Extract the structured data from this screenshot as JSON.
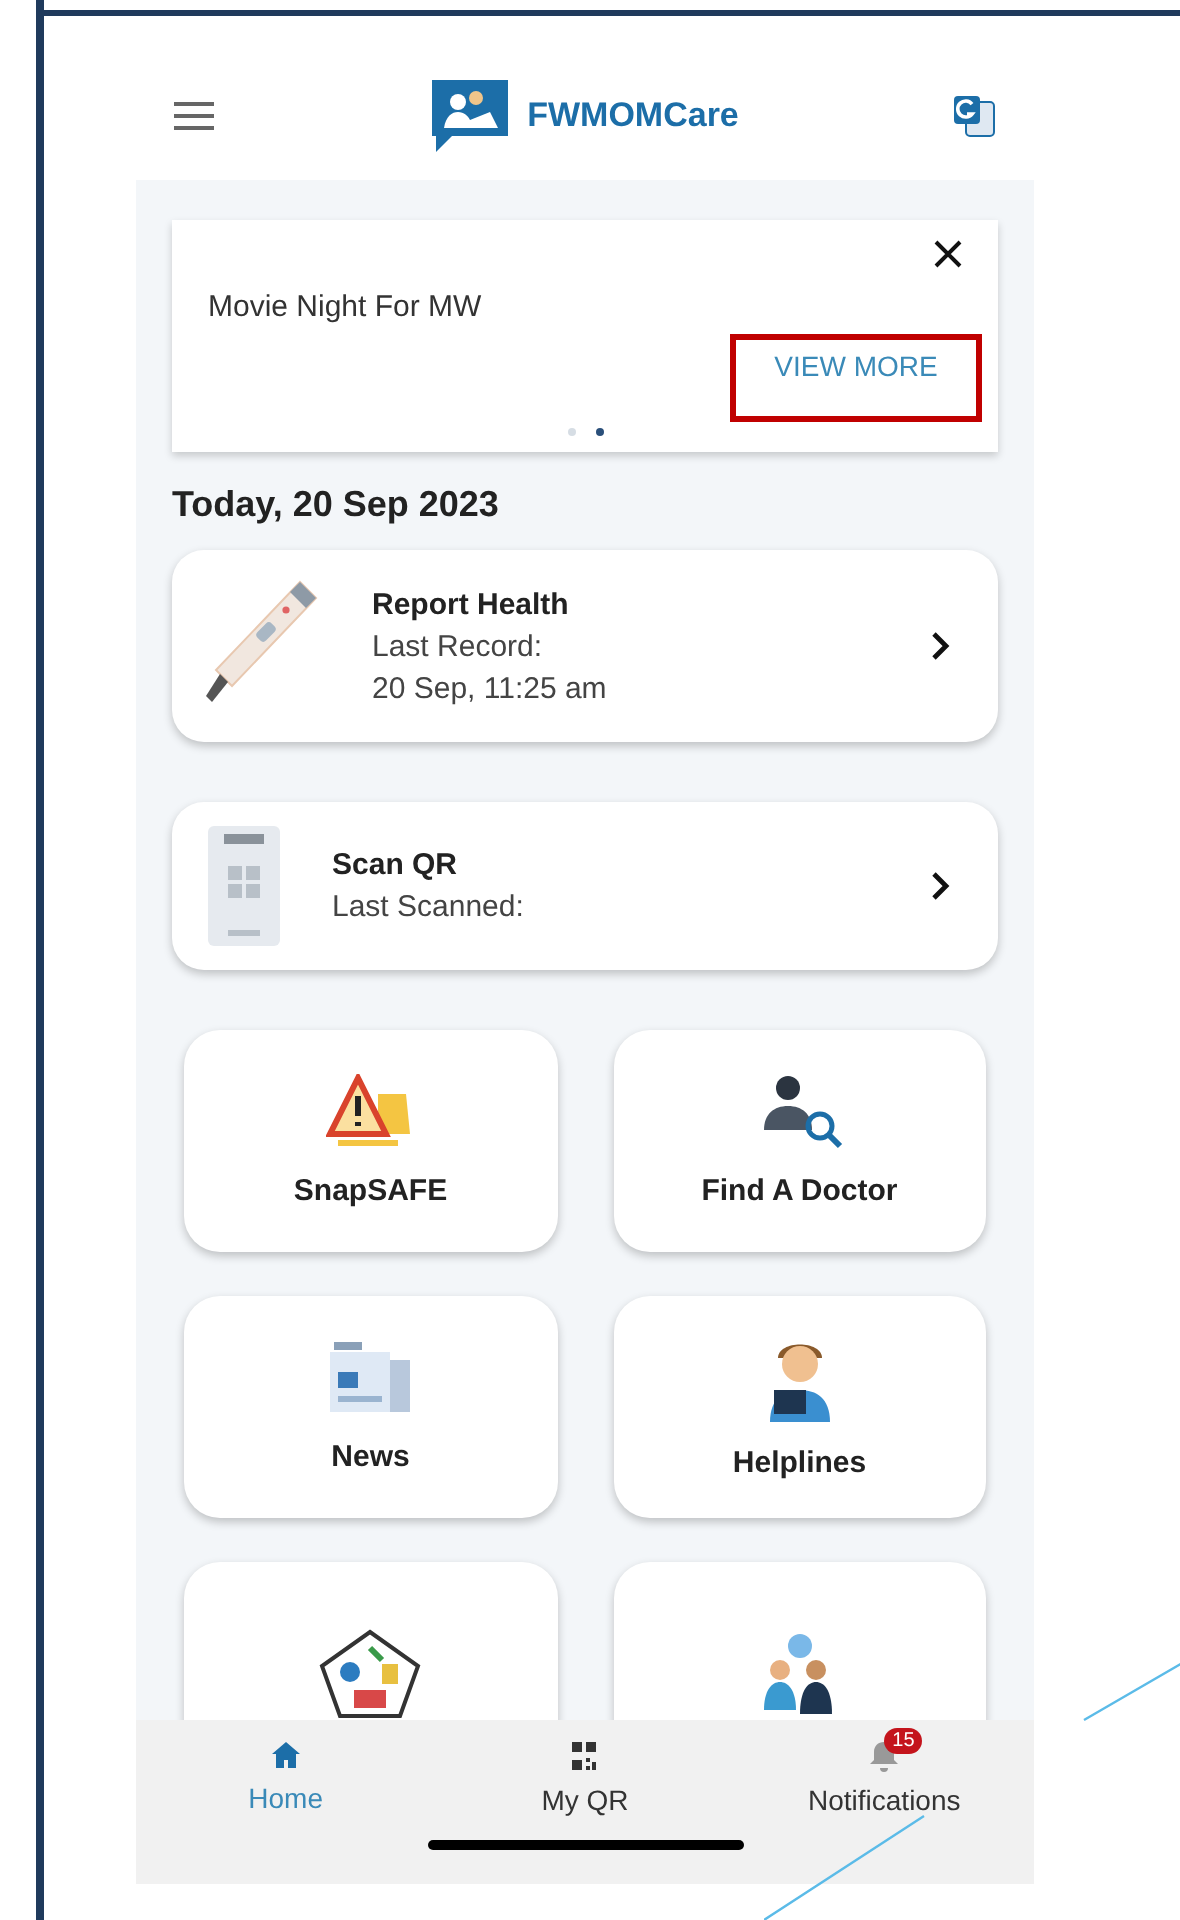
{
  "header": {
    "app_name": "FWMOMCare"
  },
  "banner": {
    "text": "Movie Night For MW",
    "action": "VIEW MORE",
    "highlighted": true,
    "dots": [
      {
        "selected": false
      },
      {
        "selected": true
      }
    ]
  },
  "date_heading": "Today, 20 Sep 2023",
  "cards": [
    {
      "kind": "thermometer",
      "title": "Report Health",
      "lines": [
        "Last Record:",
        "20 Sep, 11:25 am"
      ]
    },
    {
      "kind": "scanner",
      "title": "Scan QR",
      "lines": [
        "Last Scanned:"
      ]
    }
  ],
  "tiles": [
    {
      "kind": "warning",
      "label": "SnapSAFE"
    },
    {
      "kind": "doctor",
      "label": "Find A Doctor"
    },
    {
      "kind": "news",
      "label": "News"
    },
    {
      "kind": "helpline",
      "label": "Helplines"
    },
    {
      "kind": "pentagon"
    },
    {
      "kind": "chat"
    }
  ],
  "nav": [
    {
      "kind": "home",
      "label": "Home",
      "selected": true
    },
    {
      "kind": "qr",
      "label": "My QR",
      "selected": false
    },
    {
      "kind": "bell",
      "label": "Notifications",
      "selected": false,
      "badge": "15"
    }
  ]
}
